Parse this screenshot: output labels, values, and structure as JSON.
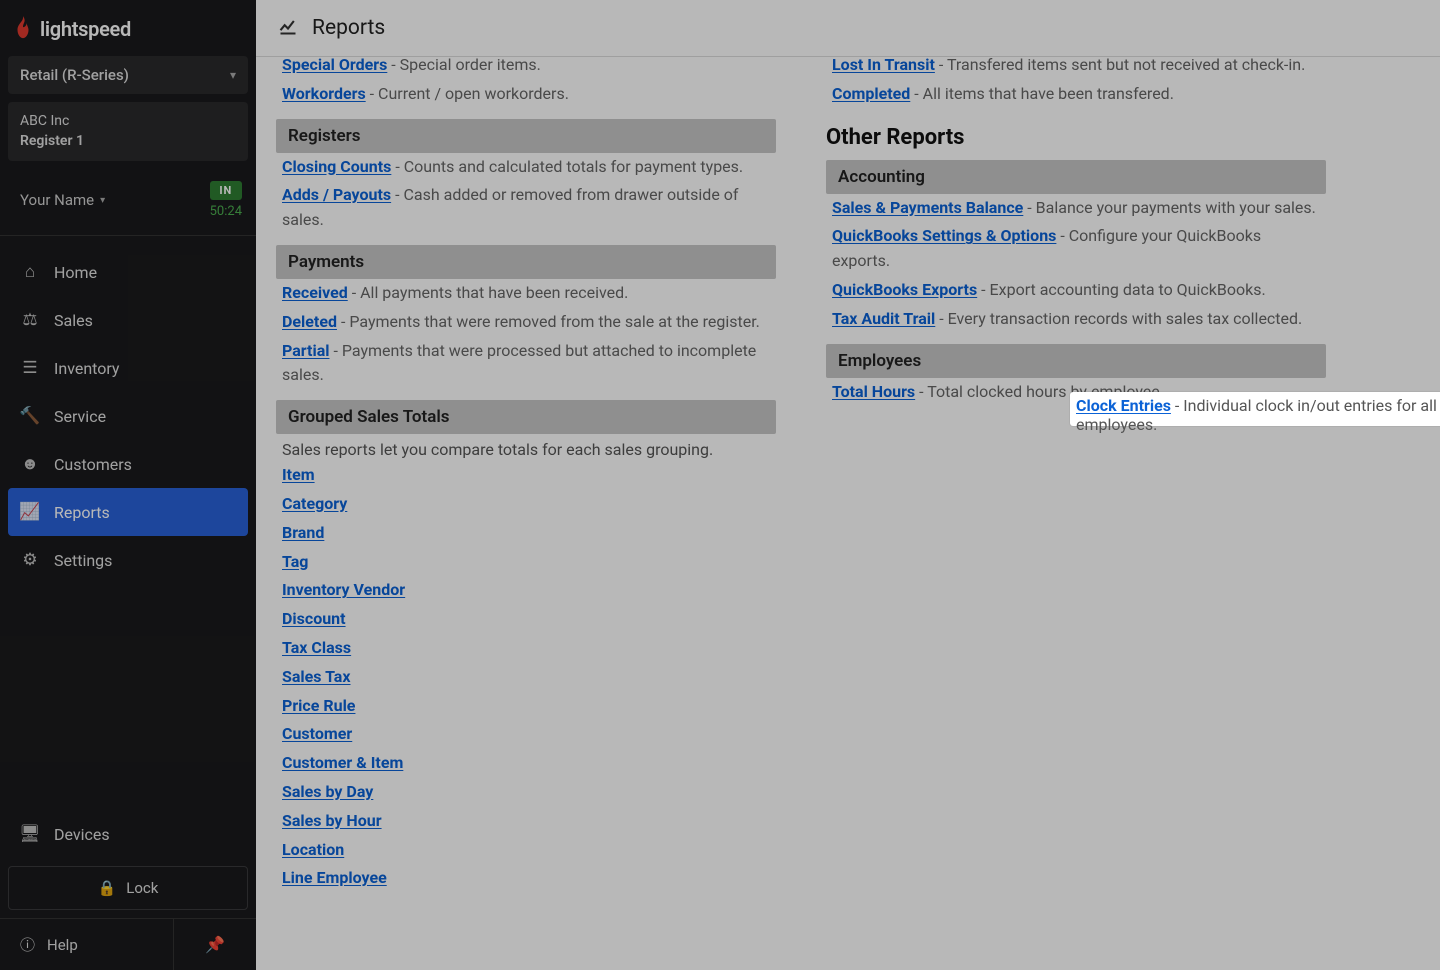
{
  "brand": "lightspeed",
  "series_select": "Retail (R-Series)",
  "company": "ABC Inc",
  "register": "Register 1",
  "user_name": "Your Name",
  "in_badge": "IN",
  "timer": "50:24",
  "nav": {
    "home": "Home",
    "sales": "Sales",
    "inventory": "Inventory",
    "service": "Service",
    "customers": "Customers",
    "reports": "Reports",
    "settings": "Settings",
    "devices": "Devices",
    "lock": "Lock",
    "help": "Help"
  },
  "page_title": "Reports",
  "left": {
    "special_orders": {
      "label": "Special Orders",
      "desc": " - Special order items."
    },
    "workorders": {
      "label": "Workorders",
      "desc": " - Current / open workorders."
    },
    "registers_band": "Registers",
    "closing_counts": {
      "label": "Closing Counts",
      "desc": " - Counts and calculated totals for payment types."
    },
    "adds_payouts": {
      "label": "Adds / Payouts",
      "desc": " - Cash added or removed from drawer outside of sales."
    },
    "payments_band": "Payments",
    "received": {
      "label": "Received",
      "desc": " - All payments that have been received."
    },
    "deleted": {
      "label": "Deleted",
      "desc": " - Payments that were removed from the sale at the register."
    },
    "partial": {
      "label": "Partial",
      "desc": " - Payments that were processed but attached to incomplete sales."
    },
    "grouped_band": "Grouped Sales Totals",
    "grouped_intro": "Sales reports let you compare totals for each sales grouping.",
    "g": [
      "Item",
      "Category",
      "Brand",
      "Tag",
      "Inventory Vendor",
      "Discount",
      "Tax Class",
      "Sales Tax",
      "Price Rule",
      "Customer",
      "Customer & Item",
      "Sales by Day",
      "Sales by Hour",
      "Location",
      "Line Employee"
    ]
  },
  "right": {
    "lost_transit": {
      "label": "Lost In Transit",
      "desc": " - Transfered items sent but not received at check-in."
    },
    "completed": {
      "label": "Completed",
      "desc": " - All items that have been transfered."
    },
    "other_title": "Other Reports",
    "accounting_band": "Accounting",
    "sp_balance": {
      "label": "Sales & Payments Balance",
      "desc": " - Balance your payments with your sales."
    },
    "qb_settings": {
      "label": "QuickBooks Settings & Options",
      "desc": " - Configure your QuickBooks exports."
    },
    "qb_exports": {
      "label": "QuickBooks Exports",
      "desc": " - Export accounting data to QuickBooks."
    },
    "tax_audit": {
      "label": "Tax Audit Trail",
      "desc": " - Every transaction records with sales tax collected."
    },
    "employees_band": "Employees",
    "total_hours": {
      "label": "Total Hours",
      "desc": " - Total clocked hours by employee."
    },
    "clock_entries": {
      "label": "Clock Entries",
      "desc": " - Individual clock in/out entries for all employees."
    }
  }
}
